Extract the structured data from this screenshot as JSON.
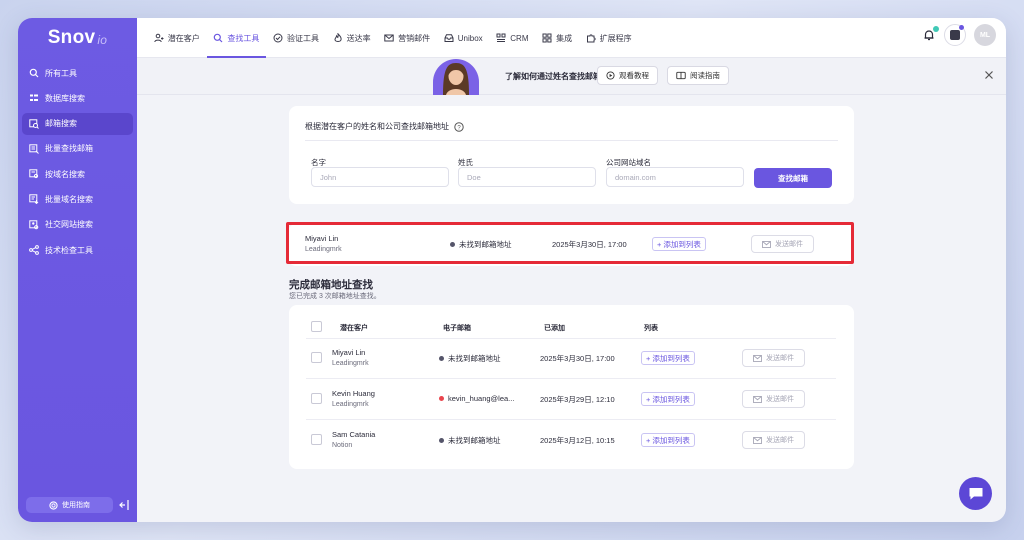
{
  "logo": {
    "main": "Snov",
    "suffix": "io"
  },
  "sidebar": {
    "items": [
      {
        "label": "所有工具",
        "icon": "search-icon"
      },
      {
        "label": "数据库搜索",
        "icon": "database-icon"
      },
      {
        "label": "邮箱搜索",
        "icon": "mail-search-icon",
        "active": true
      },
      {
        "label": "批量查找邮箱",
        "icon": "bulk-mail-icon"
      },
      {
        "label": "按域名搜索",
        "icon": "domain-icon"
      },
      {
        "label": "批量域名搜索",
        "icon": "bulk-domain-icon"
      },
      {
        "label": "社交网站搜索",
        "icon": "social-icon"
      },
      {
        "label": "技术检查工具",
        "icon": "tech-icon"
      }
    ],
    "guide_label": "使用指南"
  },
  "topnav": {
    "tabs": [
      {
        "label": "潜在客户",
        "icon": "people-icon"
      },
      {
        "label": "查找工具",
        "icon": "search-icon",
        "active": true
      },
      {
        "label": "验证工具",
        "icon": "check-circle-icon"
      },
      {
        "label": "送达率",
        "icon": "flame-icon"
      },
      {
        "label": "营销邮件",
        "icon": "mail-icon"
      },
      {
        "label": "Unibox",
        "icon": "inbox-icon"
      },
      {
        "label": "CRM",
        "icon": "crm-icon"
      },
      {
        "label": "集成",
        "icon": "grid-icon"
      },
      {
        "label": "扩展程序",
        "icon": "puzzle-icon"
      }
    ],
    "avatar_initials": "ML"
  },
  "banner": {
    "text": "了解如何通过姓名查找邮箱",
    "watch_label": "观看教程",
    "read_label": "阅读指南"
  },
  "search_form": {
    "title": "根据潜在客户的姓名和公司查找邮箱地址",
    "first_name_label": "名字",
    "first_name_placeholder": "John",
    "last_name_label": "姓氏",
    "last_name_placeholder": "Doe",
    "domain_label": "公司网站域名",
    "domain_placeholder": "domain.com",
    "submit_label": "查找邮箱"
  },
  "current_result": {
    "name": "Miyavi Lin",
    "company": "Leadingmrk",
    "status": "未找到邮箱地址",
    "date": "2025年3月30日, 17:00",
    "add_label": "添加到列表",
    "send_label": "发送邮件"
  },
  "completed": {
    "title": "完成邮箱地址查找",
    "subtitle": "您已完成 3 次邮箱地址查找。",
    "headers": {
      "prospect": "潜在客户",
      "email": "电子邮箱",
      "added": "已添加",
      "list": "列表"
    },
    "rows": [
      {
        "name": "Miyavi Lin",
        "company": "Leadingmrk",
        "status": "未找到邮箱地址",
        "status_color": "#55556a",
        "date": "2025年3月30日, 17:00",
        "add_label": "添加到列表",
        "send_label": "发送邮件"
      },
      {
        "name": "Kevin Huang",
        "company": "Leadingmrk",
        "status": "kevin_huang@lea...",
        "status_color": "#e9454d",
        "date": "2025年3月29日, 12:10",
        "add_label": "添加到列表",
        "send_label": "发送邮件"
      },
      {
        "name": "Sam Catania",
        "company": "Notion",
        "status": "未找到邮箱地址",
        "status_color": "#55556a",
        "date": "2025年3月12日, 10:15",
        "add_label": "添加到列表",
        "send_label": "发送邮件"
      }
    ]
  },
  "colors": {
    "brand": "#6a56e0",
    "highlight": "#e52a37",
    "background": "#f2f3f8"
  }
}
